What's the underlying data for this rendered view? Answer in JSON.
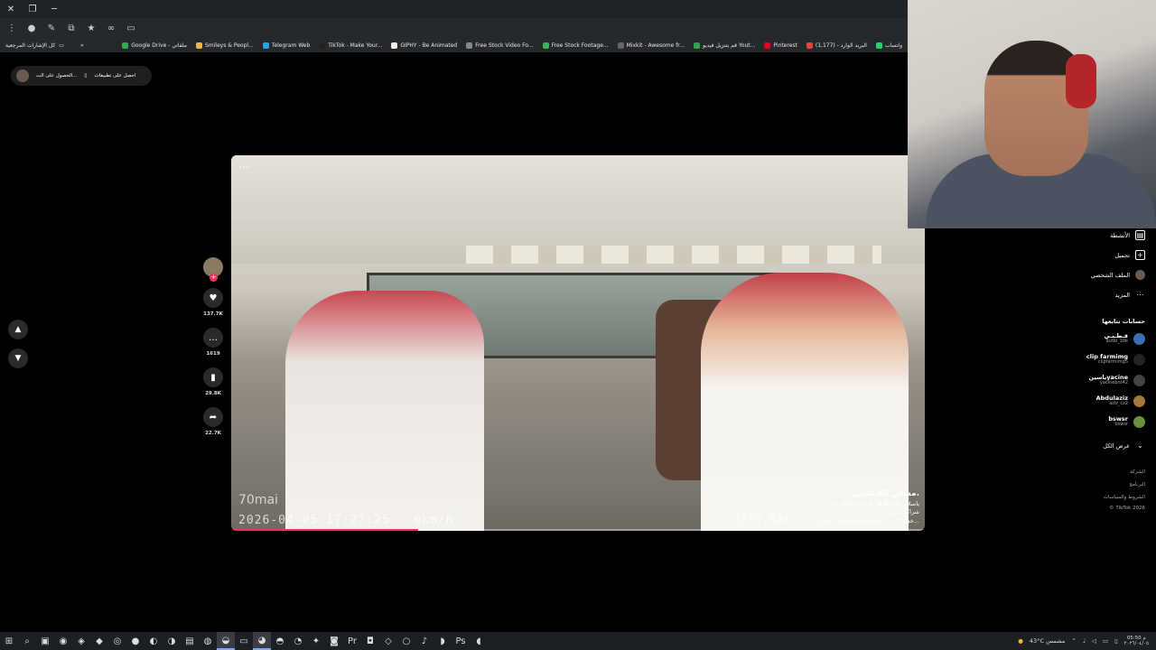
{
  "browser": {
    "window_controls": [
      "✕",
      "❐",
      "─"
    ],
    "bookmarks": [
      {
        "label": "واتساب",
        "color": "#25d366"
      },
      {
        "label": "البريد الوارد - (1,177)",
        "color": "#ea4335"
      },
      {
        "label": "Pinterest",
        "color": "#e60023"
      },
      {
        "label": "قم بتنزيل فيديو Yout...",
        "color": "#2ea44f"
      },
      {
        "label": "Mixkit - Awesome fr...",
        "color": "#666666"
      },
      {
        "label": "Free Stock Footage...",
        "color": "#3bb25a"
      },
      {
        "label": "Free Stock Video Fo...",
        "color": "#888888"
      },
      {
        "label": "GIPHY - Be Animated",
        "color": "#eeeeee"
      },
      {
        "label": "TikTok - Make Your...",
        "color": "#222222"
      },
      {
        "label": "Telegram Web",
        "color": "#2aa3e0"
      },
      {
        "label": "Smileys & Peopl...",
        "color": "#f5b53f"
      },
      {
        "label": "Google Drive - ملفاتي",
        "color": "#34a853"
      }
    ],
    "bookmarks_more": "»",
    "all_bookmarks": "كل الإشارات المرجعية"
  },
  "app_bar": {
    "get_app": "احصل على تطبيقات",
    "get_on": "الحصول على الت..."
  },
  "video": {
    "more_icon": "⋯",
    "watermark": "70mai",
    "timestamp": "2026-04-05 17:27:25",
    "speed": "0km/h",
    "coords": "35°0.924",
    "progress": 0.27,
    "author": "مسلي الفشانين.",
    "description": "ياسلام سلم 😂😂 #نجران #الترند",
    "paid": "شراكة مدفوعة",
    "music": "♫ ايوب طارش AyoubTaresh - خضر الزيـ..."
  },
  "actions": {
    "likes": "137.7K",
    "comments": "1619",
    "saves": "29.8K",
    "shares": "22.7K"
  },
  "sidebar": {
    "activity": "الأنشطة",
    "upload": "تحميل",
    "profile": "الملف الشخصي",
    "more": "المزيد",
    "following_header": "حسابات تتابعها",
    "accounts": [
      {
        "name": "قـطـبـي",
        "handle": "9utbi_10k",
        "color": "#3b6fb0"
      },
      {
        "name": "clip farmimg",
        "handle": "clipfarmimg5",
        "color": "#222222"
      },
      {
        "name": "ياسينyacine",
        "handle": "yacinebnt42",
        "color": "#444444"
      },
      {
        "name": "Abdulaziz",
        "handle": "aziz_cz2",
        "color": "#a5773c"
      },
      {
        "name": "bswsr",
        "handle": "bswsr",
        "color": "#6b8f3b"
      }
    ],
    "show_all": "عرض الكل",
    "footer": [
      "الشركة",
      "البرنامج",
      "الشروط والسياسات",
      "© TikTok 2026"
    ]
  },
  "taskbar": {
    "weather": "43°C مشمس",
    "time": "05:50 م",
    "date": "٢٠٢٦/٠٤/٠٥"
  }
}
